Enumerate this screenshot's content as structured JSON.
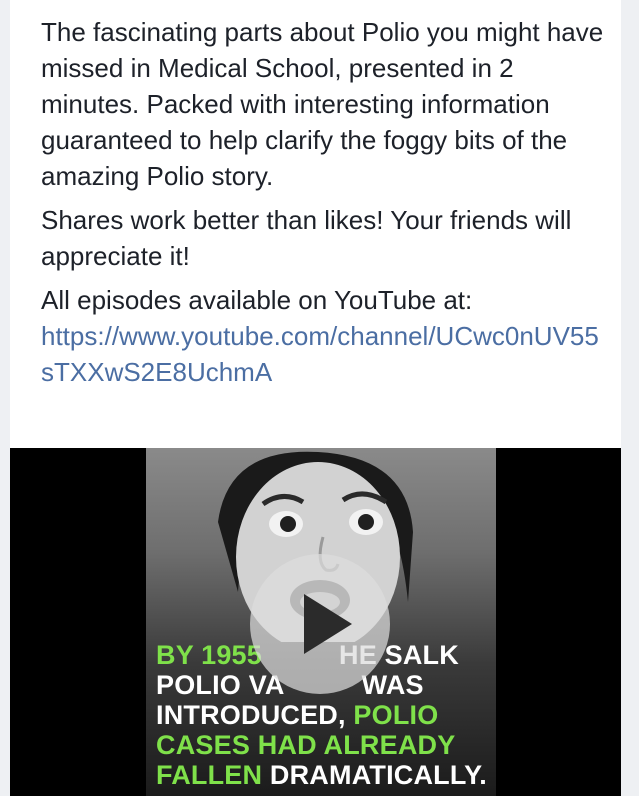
{
  "post": {
    "paragraphs": [
      "The fascinating parts about Polio you might have missed in Medical School, presented in 2 minutes. Packed with interesting information guaranteed to help clarify the foggy bits of the amazing Polio story.",
      "Shares work better than likes! Your friends will appreciate it!"
    ],
    "youtube_intro": "All episodes available on YouTube at:",
    "youtube_link": "https://www.youtube.com/channel/UCwc0nUV55sTXXwS2E8UchmA"
  },
  "video": {
    "caption": {
      "line1_a": "BY 1955",
      "line1_b": "HE SALK",
      "line2_a": "POLIO VA",
      "line2_b": "WAS",
      "line3_a": "INTRODUCED,",
      "line3_b": "POLIO",
      "line4": "CASES HAD ALREADY",
      "line5_a": "FALLEN",
      "line5_b": "DRAMATICALLY."
    },
    "colors": {
      "highlight": "#7fe14a",
      "background": "#000000"
    },
    "play_icon": "play-icon"
  }
}
